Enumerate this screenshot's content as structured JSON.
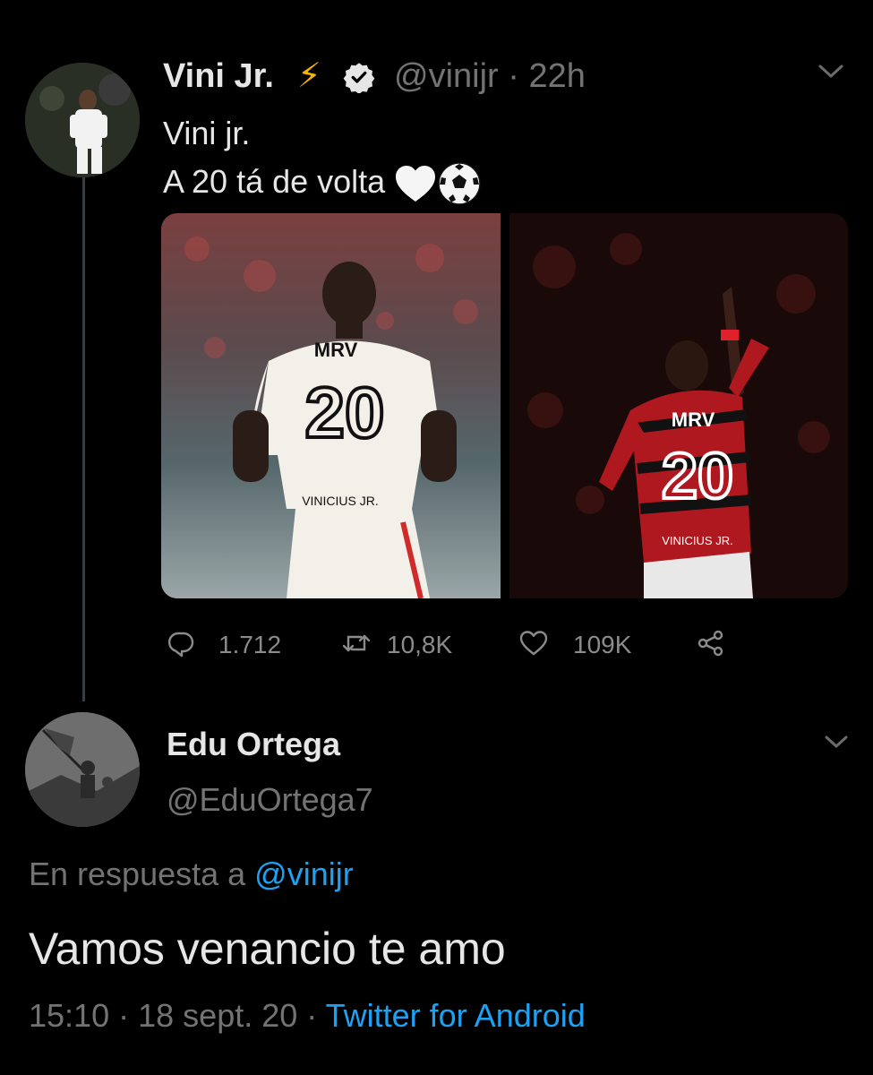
{
  "tweet": {
    "author_name": "Vini Jr.",
    "author_emoji": "⚡",
    "verified_icon": "verified-badge-icon",
    "handle": "@vinijr",
    "separator": "·",
    "time_ago": "22h",
    "text_lines": [
      "Vini jr.",
      "A 20 tá de volta"
    ],
    "text_emojis": [
      "white-heart-icon",
      "soccer-ball-icon"
    ],
    "media": [
      {
        "icon": "photo-player-back-white-kit",
        "shirt_sponsor": "MRV",
        "number": "20",
        "name": "VINICIUS JR."
      },
      {
        "icon": "photo-player-celebrating-red-black-kit",
        "shirt_sponsor": "MRV",
        "number": "20",
        "name": "VINICIUS JR."
      }
    ],
    "actions": {
      "reply_count": "1.712",
      "retweet_count": "10,8K",
      "like_count": "109K"
    }
  },
  "reply": {
    "author_name": "Edu Ortega",
    "handle": "@EduOrtega7",
    "replying_prefix": "En respuesta a",
    "replying_to": "@vinijr",
    "text": "Vamos venancio te amo",
    "time": "15:10",
    "date": "18 sept. 20",
    "separator": "·",
    "source": "Twitter for Android"
  },
  "colors": {
    "background": "#000000",
    "text": "#e6e6e6",
    "muted": "#737373",
    "link": "#1da1f2",
    "thread_line": "#3a3d40"
  }
}
